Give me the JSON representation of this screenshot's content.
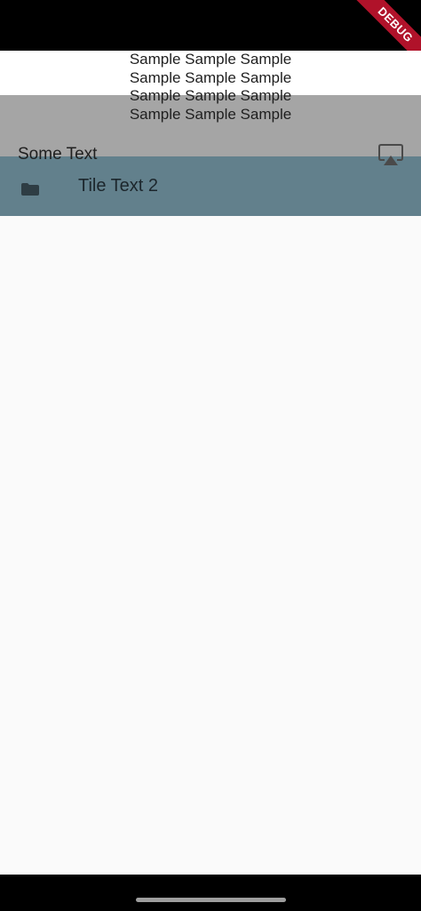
{
  "debug_banner": "DEBUG",
  "sample_lines": [
    "Sample Sample Sample",
    "Sample Sample Sample",
    "Sample Sample Sample",
    "Sample Sample Sample"
  ],
  "header": {
    "title": "Some Text",
    "action_icon": "airplay-icon"
  },
  "tile": {
    "label": "Tile Text 2",
    "icon": "folder-icon"
  },
  "colors": {
    "tile_background": "#62808c",
    "overlay": "#9e9e9e",
    "debug_ribbon": "#b0122a"
  }
}
